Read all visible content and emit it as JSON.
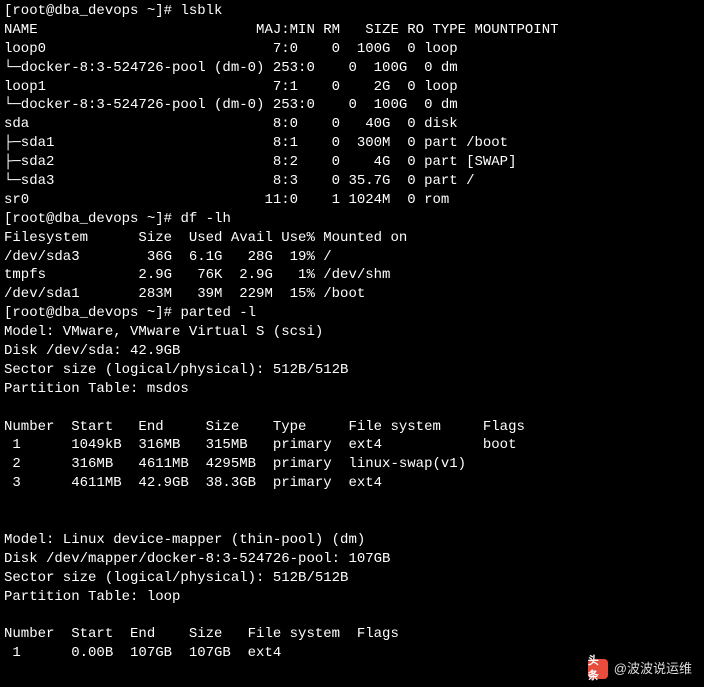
{
  "prompt_line0": "[root@dba_devops ~]# ",
  "cmd1": "lsblk",
  "lsblk": {
    "header": "NAME                          MAJ:MIN RM   SIZE RO TYPE MOUNTPOINT",
    "rows": [
      "loop0                           7:0    0  100G  0 loop",
      "└─docker-8:3-524726-pool (dm-0) 253:0    0  100G  0 dm",
      "loop1                           7:1    0    2G  0 loop",
      "└─docker-8:3-524726-pool (dm-0) 253:0    0  100G  0 dm",
      "sda                             8:0    0   40G  0 disk",
      "├─sda1                          8:1    0  300M  0 part /boot",
      "├─sda2                          8:2    0    4G  0 part [SWAP]",
      "└─sda3                          8:3    0 35.7G  0 part /",
      "sr0                            11:0    1 1024M  0 rom"
    ]
  },
  "prompt_line1": "[root@dba_devops ~]# ",
  "cmd2": "df -lh",
  "df": {
    "header": "Filesystem      Size  Used Avail Use% Mounted on",
    "rows": [
      "/dev/sda3        36G  6.1G   28G  19% /",
      "tmpfs           2.9G   76K  2.9G   1% /dev/shm",
      "/dev/sda1       283M   39M  229M  15% /boot"
    ]
  },
  "prompt_line2": "[root@dba_devops ~]# ",
  "cmd3": "parted -l",
  "parted1": {
    "model": "Model: VMware, VMware Virtual S (scsi)",
    "disk": "Disk /dev/sda: 42.9GB",
    "sector": "Sector size (logical/physical): 512B/512B",
    "ptable": "Partition Table: msdos",
    "blank1": "",
    "header": "Number  Start   End     Size    Type     File system     Flags",
    "rows": [
      " 1      1049kB  316MB   315MB   primary  ext4            boot",
      " 2      316MB   4611MB  4295MB  primary  linux-swap(v1)",
      " 3      4611MB  42.9GB  38.3GB  primary  ext4"
    ]
  },
  "blank_between": "",
  "parted2": {
    "model": "Model: Linux device-mapper (thin-pool) (dm)",
    "disk": "Disk /dev/mapper/docker-8:3-524726-pool: 107GB",
    "sector": "Sector size (logical/physical): 512B/512B",
    "ptable": "Partition Table: loop",
    "blank1": "",
    "header": "Number  Start  End    Size   File system  Flags",
    "rows": [
      " 1      0.00B  107GB  107GB  ext4"
    ]
  },
  "watermark": {
    "logo_text": "头条",
    "label": "@波波说运维"
  }
}
